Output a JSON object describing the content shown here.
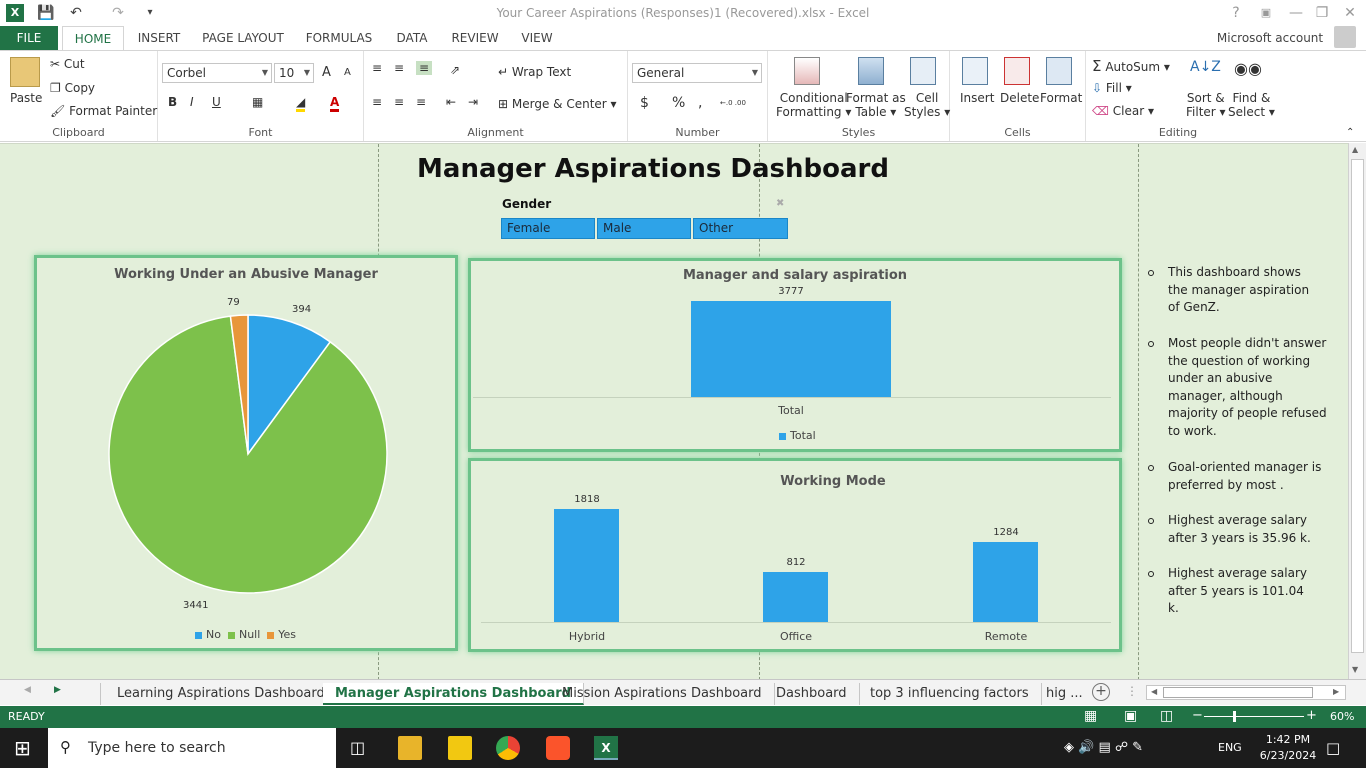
{
  "window": {
    "title": "Your Career Aspirations (Responses)1 (Recovered).xlsx - Excel",
    "help": "?",
    "controls": [
      "—",
      "❐",
      "✕"
    ]
  },
  "ribbon_tabs": [
    "FILE",
    "HOME",
    "INSERT",
    "PAGE LAYOUT",
    "FORMULAS",
    "DATA",
    "REVIEW",
    "VIEW"
  ],
  "account": "Microsoft account",
  "clipboard": {
    "paste": "Paste",
    "cut": "Cut",
    "copy": "Copy",
    "format_painter": "Format Painter",
    "label": "Clipboard"
  },
  "font": {
    "name": "Corbel",
    "size": "10",
    "grow": "A",
    "shrink": "A",
    "bold": "B",
    "italic": "I",
    "underline": "U",
    "label": "Font"
  },
  "alignment": {
    "wrap": "Wrap Text",
    "merge": "Merge & Center",
    "label": "Alignment"
  },
  "number": {
    "format": "General",
    "currency": "$",
    "percent": "%",
    "comma": ",",
    "inc_dec": "←.0 .00",
    "dec_dec": ".00 →.0",
    "label": "Number"
  },
  "styles": {
    "conditional": "Conditional",
    "conditional2": "Formatting",
    "format_as": "Format as",
    "format_as2": "Table",
    "cell": "Cell",
    "cell2": "Styles",
    "label": "Styles"
  },
  "cells": {
    "insert": "Insert",
    "delete": "Delete",
    "format": "Format",
    "label": "Cells"
  },
  "editing": {
    "autosum": "AutoSum",
    "fill": "Fill",
    "clear": "Clear",
    "sort": "Sort &",
    "sort2": "Filter",
    "find": "Find &",
    "find2": "Select",
    "label": "Editing"
  },
  "dashboard": {
    "title": "Manager Aspirations Dashboard",
    "slicer": {
      "title": "Gender",
      "items": [
        "Female",
        "Male",
        "Other"
      ]
    },
    "notes": [
      "This dashboard shows the manager aspiration of GenZ.",
      "Most people didn't answer the question of working under an abusive manager, although majority of people refused to work.",
      "Goal-oriented manager is preferred by most .",
      "Highest average salary after 3 years is 35.96 k.",
      "Highest average salary after 5 years is 101.04 k."
    ]
  },
  "chart_data": [
    {
      "type": "pie",
      "title": "Working Under an Abusive Manager",
      "categories": [
        "No",
        "Null",
        "Yes"
      ],
      "values": [
        394,
        3441,
        79
      ],
      "colors": [
        "#2ea3e8",
        "#7dc14b",
        "#e8963a"
      ],
      "legend": "bottom"
    },
    {
      "type": "bar",
      "title": "Manager and salary aspiration",
      "categories": [
        "Total"
      ],
      "series": [
        {
          "name": "Total",
          "values": [
            3777
          ]
        }
      ],
      "colors": [
        "#2ea3e8"
      ],
      "legend": "bottom"
    },
    {
      "type": "bar",
      "title": "Working Mode",
      "categories": [
        "Hybrid",
        "Office",
        "Remote"
      ],
      "values": [
        1818,
        812,
        1284
      ],
      "colors": [
        "#2ea3e8"
      ]
    }
  ],
  "sheet_tabs": [
    "Learning Aspirations Dashboard",
    "Manager Aspirations Dashboard",
    "Mission Aspirations Dashboard",
    "Dashboard",
    "top 3 influencing factors",
    "hig ..."
  ],
  "status": {
    "ready": "READY",
    "zoom": "60%",
    "zoom_level": 0.6
  },
  "taskbar": {
    "search": "Type here to search",
    "time": "1:42 PM",
    "date": "6/23/2024",
    "lang": "ENG"
  }
}
